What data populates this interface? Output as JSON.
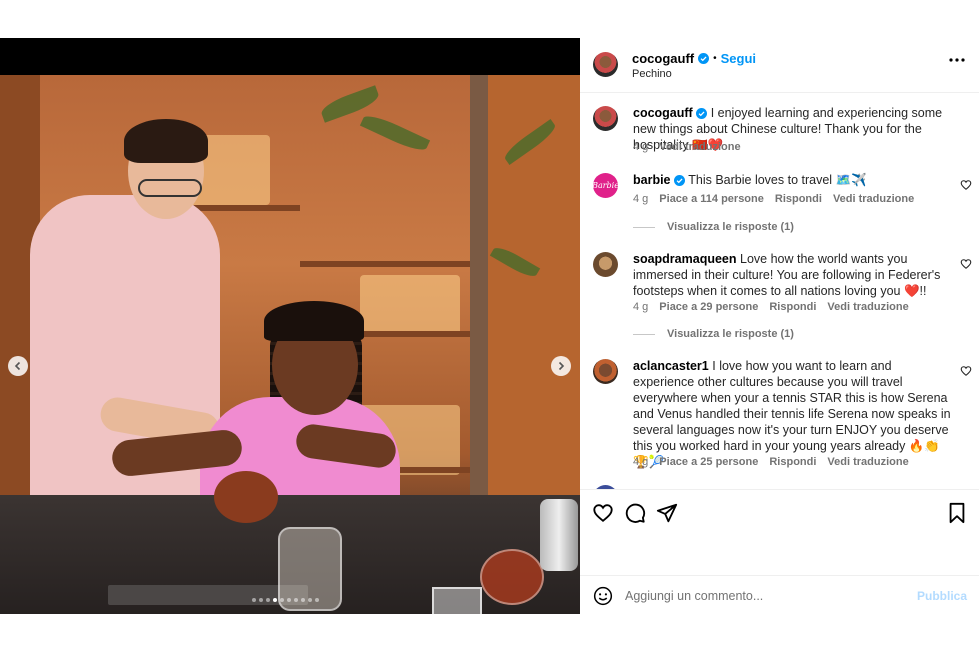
{
  "post": {
    "username": "cocogauff",
    "follow_label": "Segui",
    "separator": "•",
    "location": "Pechino",
    "carousel": {
      "total_slides": 10,
      "active_slide": 4
    }
  },
  "comments": [
    {
      "username": "cocogauff",
      "verified": true,
      "text": "I enjoyed learning and experiencing some new things about Chinese culture! Thank you for the hospitality 🇨🇳❤️",
      "time": "4 g",
      "translate": "Vedi traduzione"
    },
    {
      "username": "barbie",
      "avatar_text": "Barbie",
      "verified": true,
      "text": "This Barbie loves to travel 🗺️✈️",
      "time": "4 g",
      "likes": "Piace a 114 persone",
      "reply": "Rispondi",
      "translate": "Vedi traduzione",
      "view_replies": "Visualizza le risposte (1)"
    },
    {
      "username": "soapdramaqueen",
      "verified": false,
      "text": "Love how the world wants you immersed in their culture! You are following in Federer's footsteps when it comes to all nations loving you ❤️!!",
      "time": "4 g",
      "likes": "Piace a 29 persone",
      "reply": "Rispondi",
      "translate": "Vedi traduzione",
      "view_replies": "Visualizza le risposte (1)"
    },
    {
      "username": "aclancaster1",
      "verified": false,
      "text": "I love how you want to learn and experience other cultures because you will travel everywhere when your a tennis STAR this is how Serena and Venus handled their tennis life Serena now speaks in several languages now it's your turn ENJOY you deserve this you worked hard in your young years already 🔥👏🏆🎾",
      "time": "4 g",
      "likes": "Piace a 25 persone",
      "reply": "Rispondi",
      "translate": "Vedi traduzione"
    }
  ],
  "actions": {
    "icons": [
      "heart-icon",
      "comment-icon",
      "share-icon",
      "bookmark-icon"
    ]
  },
  "add_comment": {
    "placeholder": "Aggiungi un commento...",
    "publish_label": "Pubblica",
    "emoji_icon": "smiley-icon"
  },
  "colors": {
    "accent_blue": "#0095f6",
    "verified_blue": "#0095f6",
    "barbie_pink": "#e0218a",
    "muted_text": "#737373"
  }
}
